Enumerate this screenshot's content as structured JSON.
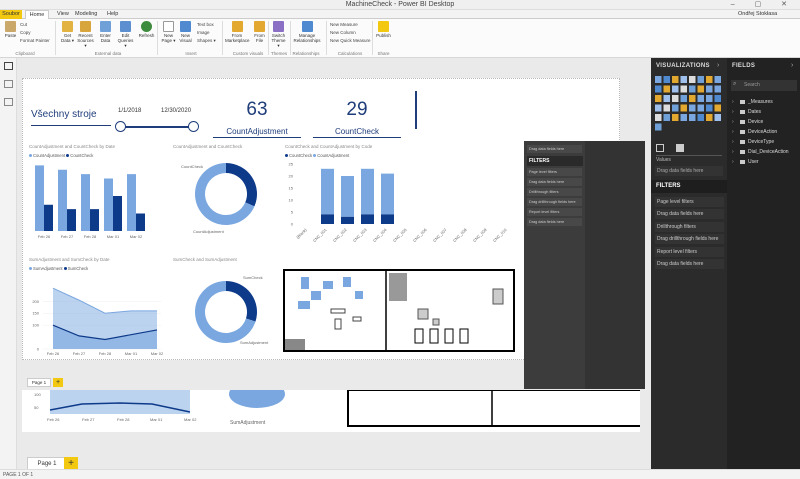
{
  "window": {
    "title": "MachineCheck - Power BI Desktop",
    "user": "Ondřej Stokłasa",
    "controls": "– ▢ ✕"
  },
  "menu": {
    "file": "Soubor",
    "tabs": [
      "Home",
      "View",
      "Modeling",
      "Help"
    ]
  },
  "ribbon": {
    "paste": "Paste",
    "cut": "Cut",
    "copy": "Copy",
    "format_painter": "Format Painter",
    "clipboard": "Clipboard",
    "get_data": "Get Data ▾",
    "recent_sources": "Recent Sources ▾",
    "enter_data": "Enter Data",
    "edit_queries": "Edit Queries ▾",
    "refresh": "Refresh",
    "external_data": "External data",
    "new_page": "New Page ▾",
    "new_visual": "New Visual",
    "text_box": "Text box",
    "image": "Image",
    "shapes": "Shapes ▾",
    "insert": "Insert",
    "from_marketplace": "From Marketplace",
    "from_file": "From File",
    "custom_visuals": "Custom visuals",
    "switch_theme": "Switch Theme ▾",
    "themes": "Themes",
    "manage_relationships": "Manage Relationships",
    "relationships": "Relationships",
    "new_measure": "New Measure",
    "new_column": "New Column",
    "new_quick_measure": "New Quick Measure",
    "calculations": "Calculations",
    "publish": "Publish",
    "share": "Share"
  },
  "report": {
    "heading": "Všechny stroje",
    "slider": {
      "start": "1/1/2018",
      "end": "12/30/2020"
    },
    "card1": {
      "value": "63",
      "label": "CountAdjustment"
    },
    "card2": {
      "value": "29",
      "label": "CountCheck"
    },
    "visuals": {
      "bar1_title": "CountAdjustment and CountCheck by Date",
      "donut1_title": "CountAdjustment and CountCheck",
      "bar2_title": "CountCheck and CountAdjustment by Code",
      "area_title": "SumAdjustment and SumCheck by Date",
      "donut2_title": "SumCheck and SumAdjustment"
    },
    "legend": {
      "a": "CountAdjustment",
      "b": "CountCheck",
      "c": "SumAdjustment",
      "d": "SumCheck"
    },
    "donut_labels": {
      "a": "CountCheck",
      "b": "CountAdjustment",
      "c": "SumCheck",
      "d": "SumAdjustment"
    }
  },
  "page_tab": "Page 1",
  "add_page": "+",
  "status": "PAGE 1 OF 1",
  "overlay": {
    "drop": "Drag data fields here",
    "filters": "FILTERS",
    "items": [
      "Page level filters",
      "Drag data fields here",
      "Drillthrough filters",
      "Drag drillthrough fields here",
      "Report level filters",
      "Drag data fields here"
    ]
  },
  "viz_pane": {
    "title": "VISUALIZATIONS",
    "values": "Values",
    "drop": "Drag data fields here",
    "filters": "FILTERS",
    "items": [
      "Page level filters",
      "Drag data fields here",
      "Drillthrough filters",
      "Drag drillthrough fields here",
      "Report level filters",
      "Drag data fields here"
    ]
  },
  "fields_pane": {
    "title": "FIELDS",
    "search": "Search",
    "items": [
      "_Measures",
      "Dates",
      "Device",
      "DeviceAction",
      "DeviceType",
      "Dial_DeviceAction",
      "User"
    ]
  },
  "colors": {
    "light": "#7aa7e0",
    "dark": "#0e3a8a",
    "accent": "#f2c811"
  },
  "chart_data": [
    {
      "type": "bar",
      "title": "CountAdjustment and CountCheck by Date",
      "categories": [
        "Feb 26",
        "Feb 27",
        "Feb 28",
        "Mar 01",
        "Mar 02"
      ],
      "series": [
        {
          "name": "CountAdjustment",
          "values": [
            15,
            14,
            13,
            12,
            13
          ]
        },
        {
          "name": "CountCheck",
          "values": [
            6,
            5,
            5,
            8,
            4
          ]
        }
      ],
      "ylim": [
        0,
        16
      ]
    },
    {
      "type": "pie",
      "title": "CountAdjustment and CountCheck",
      "series": [
        {
          "name": "CountAdjustment",
          "values": [
            63
          ]
        },
        {
          "name": "CountCheck",
          "values": [
            29
          ]
        }
      ]
    },
    {
      "type": "bar",
      "title": "CountCheck and CountAdjustment by Code",
      "categories": [
        "(Blank)",
        "CNC_001",
        "CNC_002",
        "CNC_003",
        "CNC_004",
        "CNC_005",
        "CNC_006",
        "CNC_007",
        "CNC_008",
        "CNC_009",
        "CNC_010"
      ],
      "series": [
        {
          "name": "CountCheck",
          "values": [
            0,
            4,
            3,
            4,
            4,
            0,
            0,
            0,
            0,
            0,
            0
          ]
        },
        {
          "name": "CountAdjustment",
          "values": [
            0,
            23,
            20,
            23,
            21,
            0,
            0,
            0,
            0,
            0,
            0
          ]
        }
      ],
      "yticks": [
        "0",
        "5",
        "10",
        "15",
        "20",
        "25"
      ],
      "ylim": [
        0,
        25
      ]
    },
    {
      "type": "area",
      "title": "SumAdjustment and SumCheck by Date",
      "categories": [
        "Feb 26",
        "Feb 27",
        "Feb 28",
        "Mar 01",
        "Mar 02"
      ],
      "series": [
        {
          "name": "SumAdjustment",
          "values": [
            255,
            205,
            150,
            160,
            160
          ]
        },
        {
          "name": "SumCheck",
          "values": [
            100,
            55,
            40,
            60,
            80
          ]
        }
      ],
      "yticks": [
        "0",
        "100",
        "150",
        "200"
      ],
      "ylim": [
        0,
        260
      ]
    },
    {
      "type": "pie",
      "title": "SumCheck and SumAdjustment",
      "series": [
        {
          "name": "SumCheck",
          "values": [
            30
          ]
        },
        {
          "name": "SumAdjustment",
          "values": [
            70
          ]
        }
      ]
    }
  ]
}
